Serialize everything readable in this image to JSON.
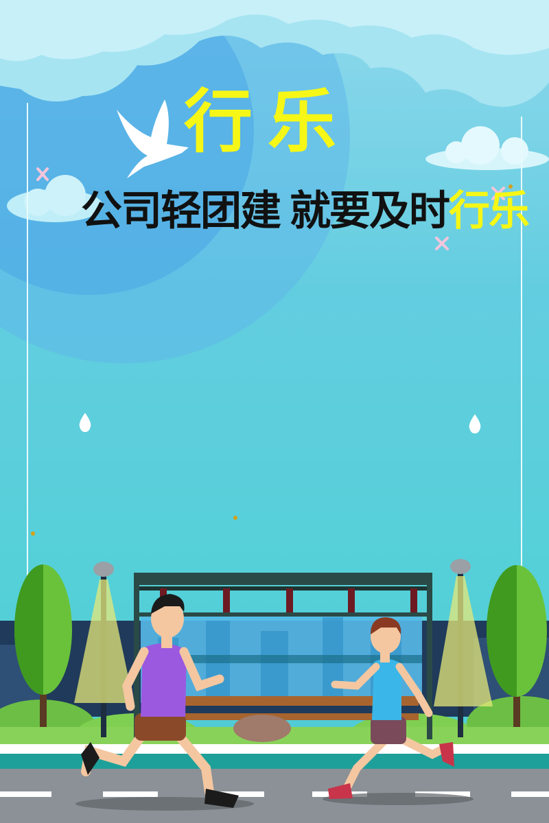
{
  "poster": {
    "title": "行乐",
    "subtitle_part1": "公司轻团建",
    "subtitle_part2": "就要及时",
    "subtitle_highlight": "行乐"
  },
  "colors": {
    "title": "#f6f716",
    "subtitle": "#111111",
    "sky_top": "#8fd8ec",
    "sky_bottom": "#4ecad4"
  },
  "icons": [
    "dove-icon",
    "sparkle-icon",
    "raindrop-icon",
    "tree-icon",
    "street-lamp-icon",
    "bus-shelter-icon",
    "runner-man-icon",
    "runner-boy-icon"
  ]
}
